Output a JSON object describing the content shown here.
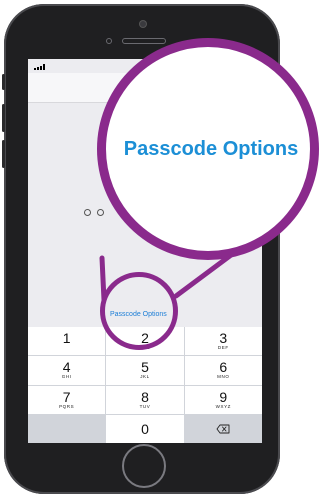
{
  "screen": {
    "passcode_dot_count": 2,
    "options_link": "Passcode Options"
  },
  "keypad": {
    "keys": [
      {
        "num": "1",
        "letters": ""
      },
      {
        "num": "2",
        "letters": "ABC"
      },
      {
        "num": "3",
        "letters": "DEF"
      },
      {
        "num": "4",
        "letters": "GHI"
      },
      {
        "num": "5",
        "letters": "JKL"
      },
      {
        "num": "6",
        "letters": "MNO"
      },
      {
        "num": "7",
        "letters": "PQRS"
      },
      {
        "num": "8",
        "letters": "TUV"
      },
      {
        "num": "9",
        "letters": "WXYZ"
      },
      {
        "num": "",
        "letters": ""
      },
      {
        "num": "0",
        "letters": ""
      },
      {
        "num": "",
        "letters": ""
      }
    ],
    "backspace_icon": "backspace-icon"
  },
  "callout": {
    "zoom_label": "Passcode Options",
    "accent_color": "#8a2a8c",
    "link_color": "#1c8fd6"
  }
}
